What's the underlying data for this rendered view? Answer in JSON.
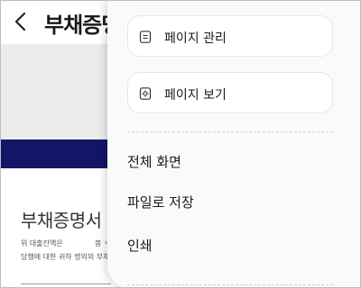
{
  "header": {
    "title": "부채증명서",
    "back_icon": "chevron-left-icon"
  },
  "background": {
    "navy_color": "#141566",
    "gray_color": "#ececec"
  },
  "document": {
    "title": "부채증명서",
    "line1_left": "위 대출잔액은",
    "line1_right": "봉 ㅋ",
    "line2": "당행에 대한 귀하 명의의 부채"
  },
  "menu": {
    "cards": [
      {
        "label": "페이지 관리",
        "icon": "page-manage-icon"
      },
      {
        "label": "페이지 보기",
        "icon": "page-view-icon"
      }
    ],
    "items": [
      {
        "label": "전체 화면"
      },
      {
        "label": "파일로 저장"
      },
      {
        "label": "인쇄"
      }
    ]
  }
}
